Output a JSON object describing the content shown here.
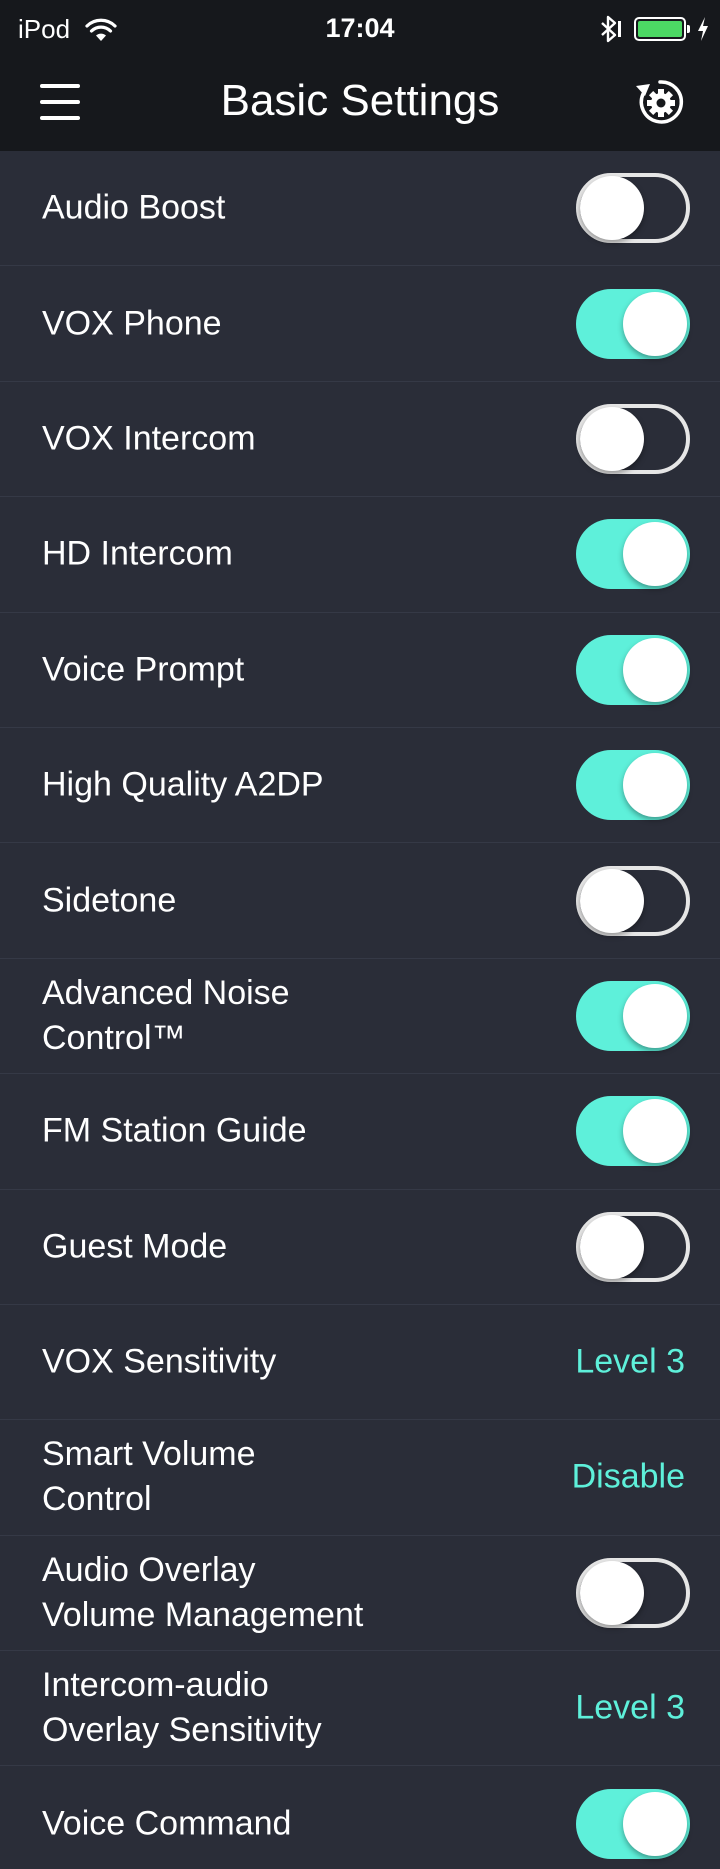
{
  "status_bar": {
    "carrier": "iPod",
    "time": "17:04"
  },
  "nav": {
    "title": "Basic Settings",
    "menu_icon": "hamburger-menu-icon",
    "reset_icon": "reset-settings-icon"
  },
  "colors": {
    "accent": "#5ef0da",
    "background": "#2a2d38",
    "header": "#16181c"
  },
  "settings": [
    {
      "label": "Audio Boost",
      "type": "toggle",
      "on": false
    },
    {
      "label": "VOX Phone",
      "type": "toggle",
      "on": true
    },
    {
      "label": "VOX Intercom",
      "type": "toggle",
      "on": false
    },
    {
      "label": "HD Intercom",
      "type": "toggle",
      "on": true
    },
    {
      "label": "Voice Prompt",
      "type": "toggle",
      "on": true
    },
    {
      "label": "High Quality A2DP",
      "type": "toggle",
      "on": true
    },
    {
      "label": "Sidetone",
      "type": "toggle",
      "on": false
    },
    {
      "label": "Advanced Noise\nControl™",
      "type": "toggle",
      "on": true
    },
    {
      "label": "FM Station Guide",
      "type": "toggle",
      "on": true
    },
    {
      "label": "Guest Mode",
      "type": "toggle",
      "on": false
    },
    {
      "label": "VOX Sensitivity",
      "type": "value",
      "value": "Level 3"
    },
    {
      "label": "Smart Volume\nControl",
      "type": "value",
      "value": "Disable"
    },
    {
      "label": "Audio Overlay\nVolume Management",
      "type": "toggle",
      "on": false
    },
    {
      "label": "Intercom-audio\nOverlay Sensitivity",
      "type": "value",
      "value": "Level 3"
    },
    {
      "label": "Voice Command",
      "type": "toggle",
      "on": true
    }
  ]
}
